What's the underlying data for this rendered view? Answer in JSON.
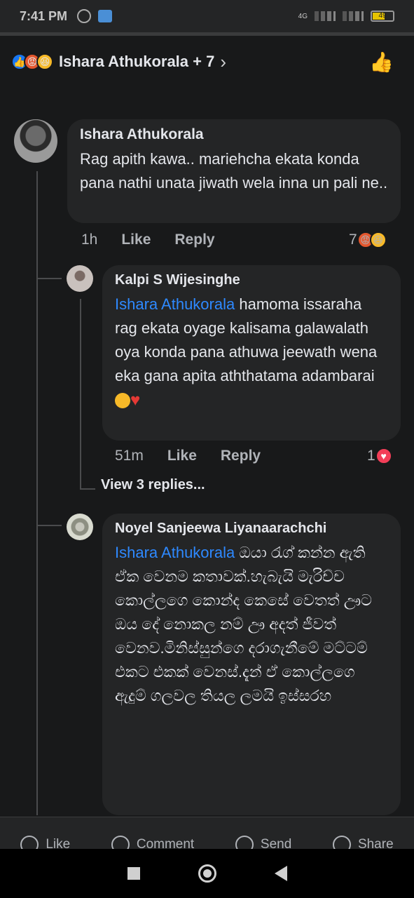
{
  "status_bar": {
    "time": "7:41 PM",
    "network": "4G",
    "battery": "49"
  },
  "header": {
    "reaction_icons": [
      "like-icon",
      "angry-icon",
      "haha-icon"
    ],
    "names": "Ishara Athukorala + 7"
  },
  "comments": [
    {
      "author": "Ishara Athukorala",
      "text": "Rag apith kawa.. mariehcha ekata konda pana nathi unata jiwath wela inna un pali ne..",
      "time": "1h",
      "like": "Like",
      "reply": "Reply",
      "reaction_count": "7"
    },
    {
      "author": "Kalpi S Wijesinghe",
      "mention": "Ishara Athukorala",
      "text": " hamoma issaraha rag ekata oyage kalisama galawalath oya konda pana athuwa jeewath wena eka gana apita aththatama adambarai ",
      "time": "51m",
      "like": "Like",
      "reply": "Reply",
      "reaction_count": "1"
    },
    {
      "author": "Noyel Sanjeewa Liyanaarachchi",
      "mention": "Ishara Athukorala",
      "text": " ඔයා රැග් කන්න ඇති ඒක වෙනම කතාවක්.හැබැයි මැරිච්ච කොල්ලගෙ කොන්ද කෙසේ වෙතත් ඌට ඔය දේ නොකල නම් ඌ අදත් ජීවත් වෙනව.මිනිස්සුන්ගෙ දරාගැනීමේ මට්ටම් එකට එකක් වෙනස්.දැන් ඒ කොල්ලගෙ ඇදුම් ගලවල තියල ලමයි ඉස්සරහ"
    }
  ],
  "view_replies": "View 3 replies...",
  "actions": {
    "like": "Like",
    "comment": "Comment",
    "send": "Send",
    "share": "Share"
  }
}
